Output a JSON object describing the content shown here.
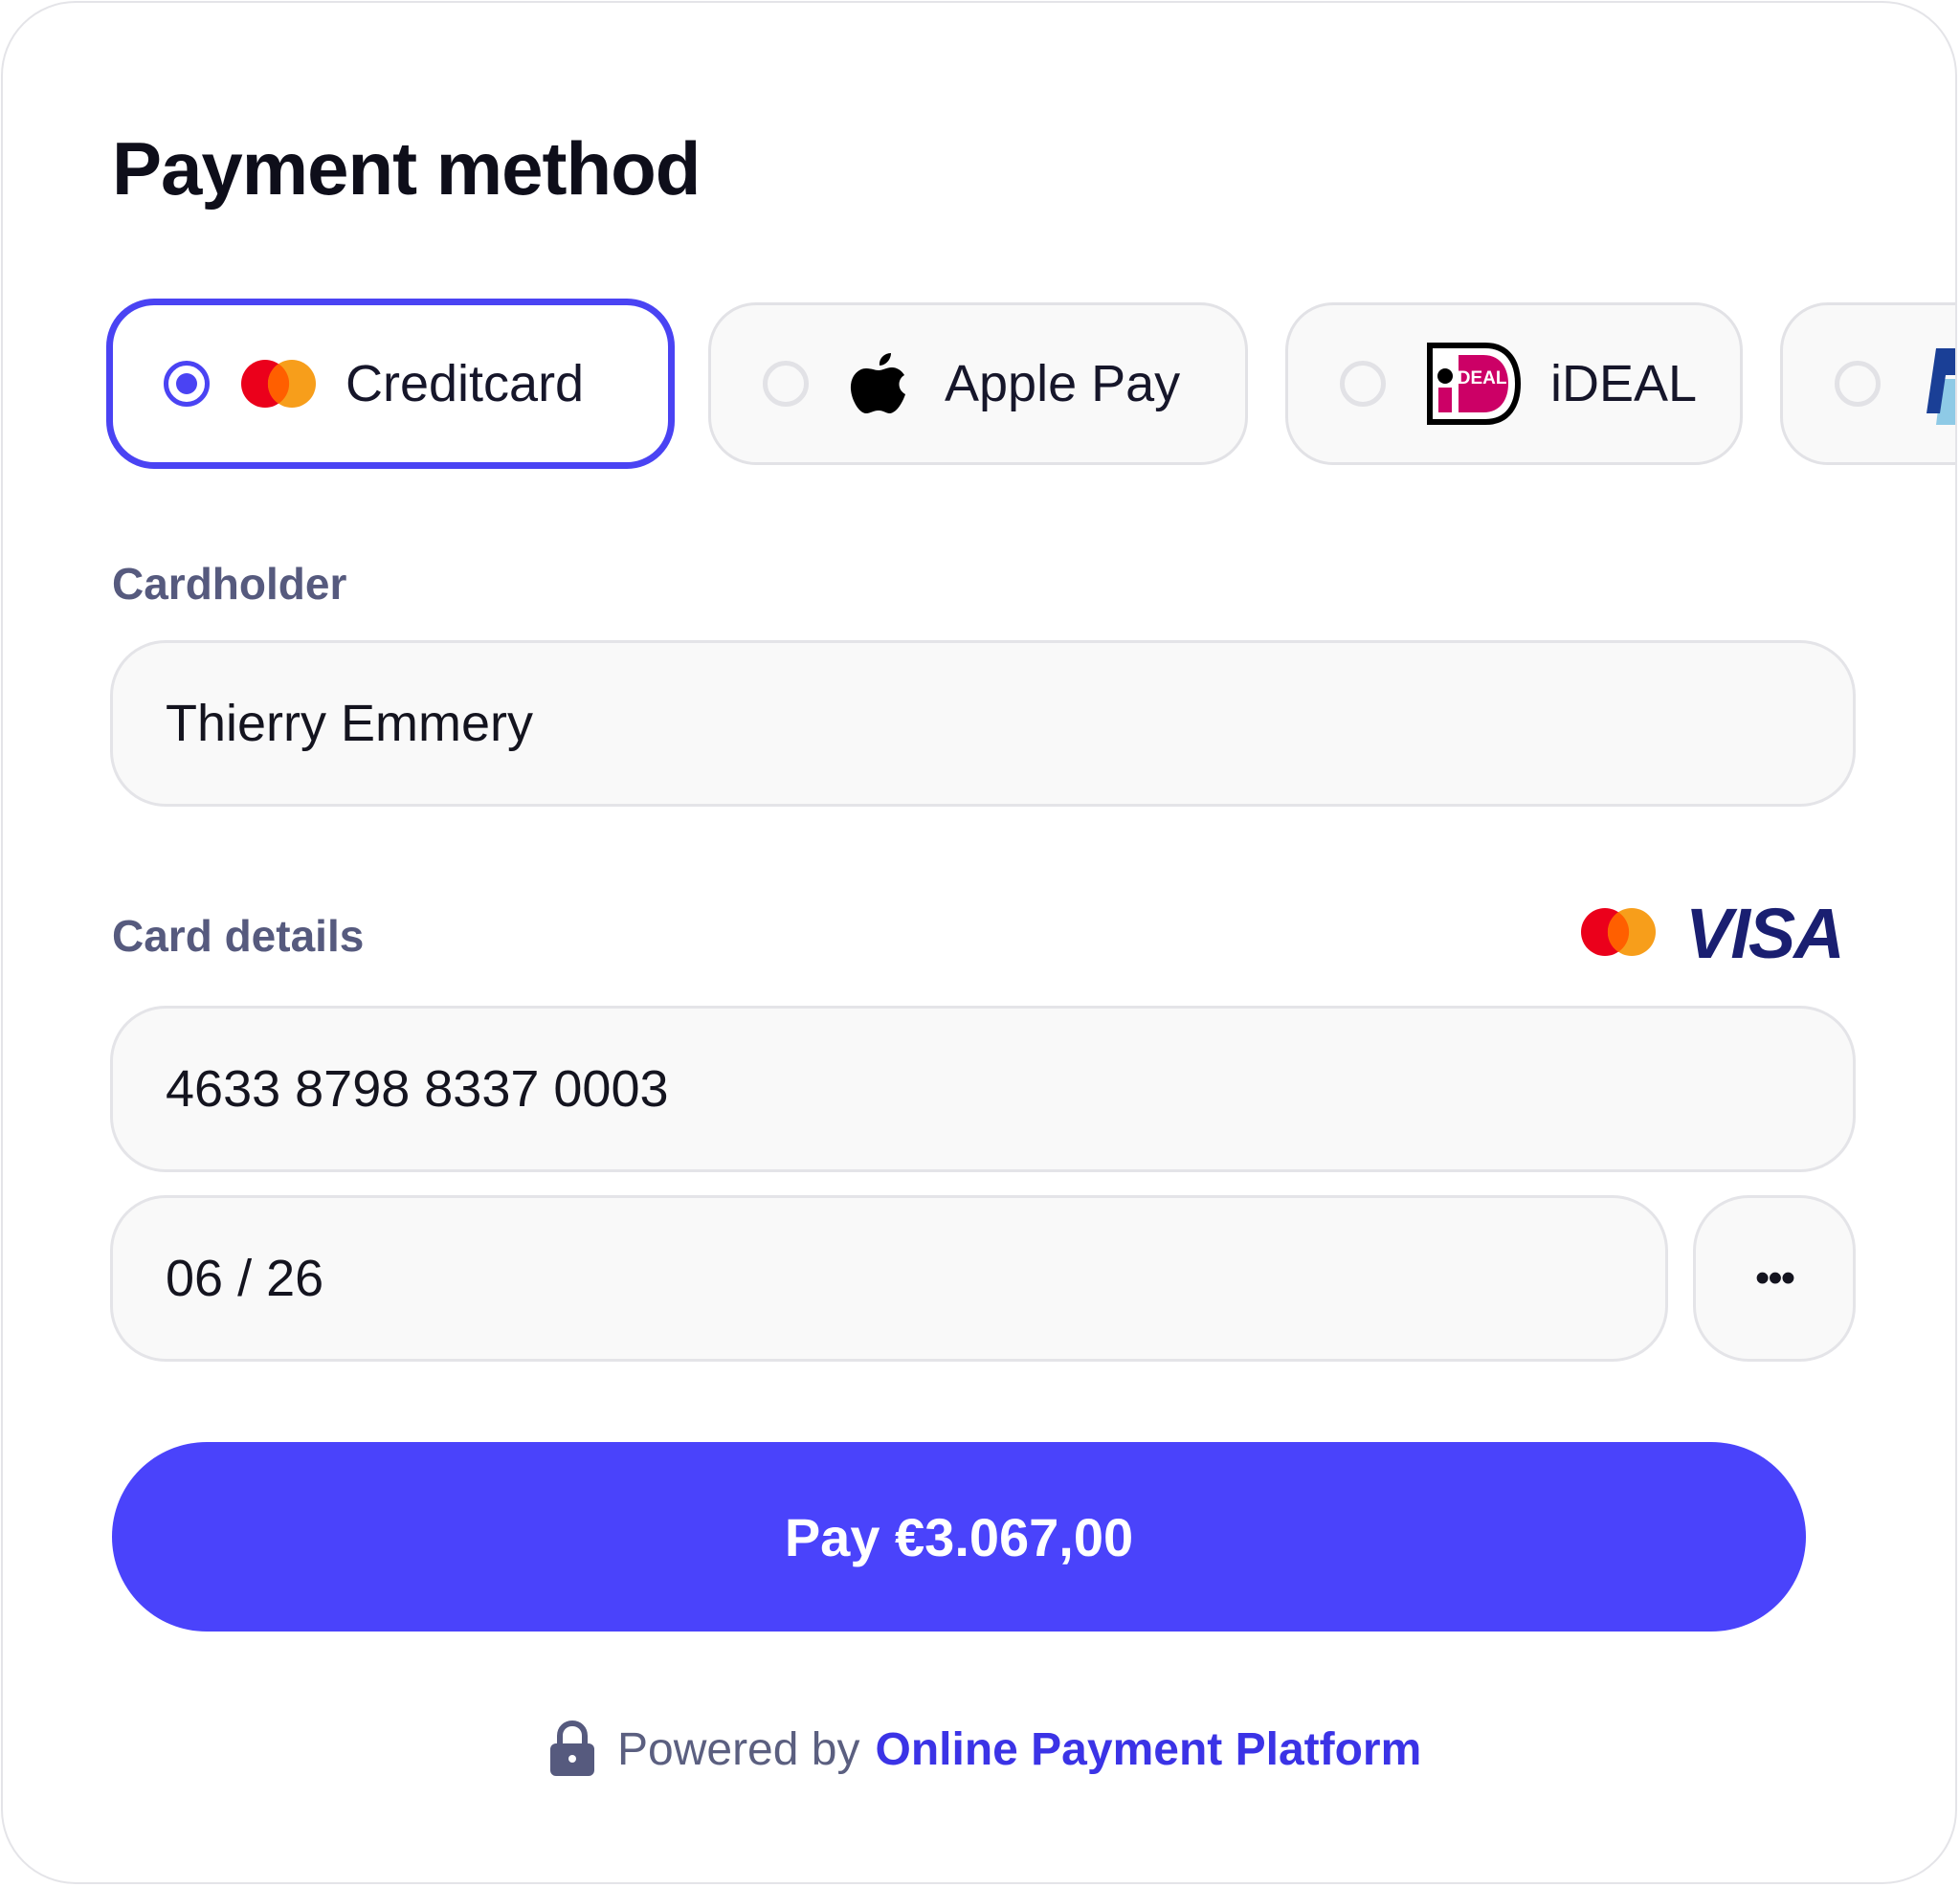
{
  "title": "Payment method",
  "methods": [
    {
      "label": "Creditcard",
      "selected": true,
      "icon": "mastercard-icon"
    },
    {
      "label": "Apple Pay",
      "selected": false,
      "icon": "apple-icon"
    },
    {
      "label": "iDEAL",
      "selected": false,
      "icon": "ideal-icon"
    },
    {
      "label": "",
      "selected": false,
      "icon": "paypal-icon"
    }
  ],
  "cardholder": {
    "label": "Cardholder",
    "value": "Thierry Emmery"
  },
  "card_details": {
    "label": "Card details",
    "number": "4633 8798 8337 0003",
    "expiry": "06 / 26",
    "cvc": "•••",
    "brand_visa": "VISA"
  },
  "ideal_logo_text": "IDEAL",
  "pay_button": {
    "label": "Pay €3.067,00"
  },
  "footer": {
    "prefix": "Powered by",
    "link": "Online Payment Platform"
  },
  "colors": {
    "accent": "#4a43fb",
    "label": "#565a7e",
    "mastercard_red": "#eb001b",
    "mastercard_orange": "#f79e1b",
    "visa_navy": "#1a1f71",
    "ideal_pink": "#cc0066"
  }
}
